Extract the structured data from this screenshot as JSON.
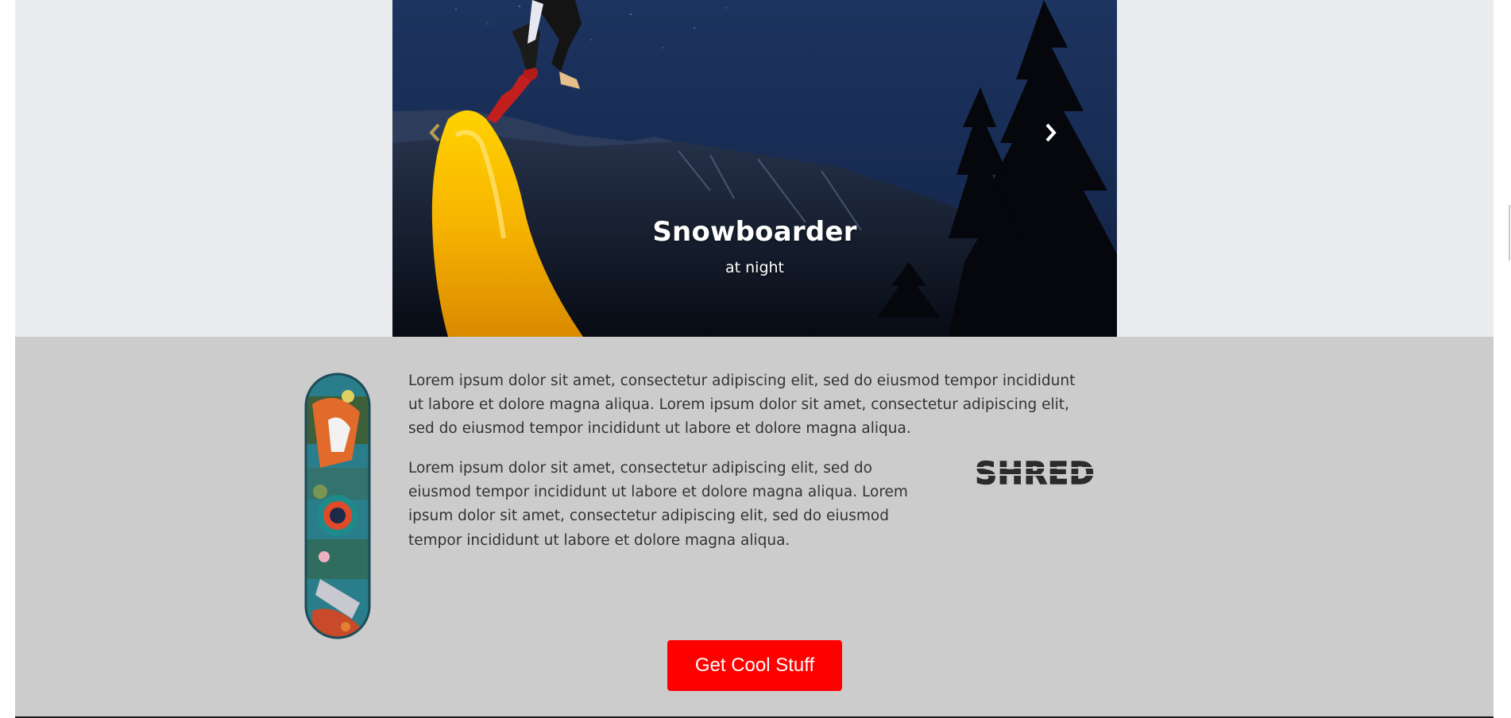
{
  "carousel": {
    "slide_title": "Snowboarder",
    "slide_subtitle": "at night",
    "prev_icon": "chevron-left-icon",
    "next_icon": "chevron-right-icon"
  },
  "content": {
    "paragraph_1": "Lorem ipsum dolor sit amet, consectetur adipiscing elit, sed do eiusmod tempor incididunt ut labore et dolore magna aliqua. Lorem ipsum dolor sit amet, consectetur adipiscing elit, sed do eiusmod tempor incididunt ut labore et dolore magna aliqua.",
    "paragraph_2": "Lorem ipsum dolor sit amet, consectetur adipiscing elit, sed do eiusmod tempor incididunt ut labore et dolore magna aliqua. Lorem ipsum dolor sit amet, consectetur adipiscing elit, sed do eiusmod tempor incididunt ut labore et dolore magna aliqua.",
    "logo_text": "SHRED",
    "cta_label": "Get Cool Stuff"
  },
  "colors": {
    "page_background": "#ebecef",
    "content_background": "#cccccc",
    "cta_background": "#ff0000",
    "cta_text": "#ffffff",
    "body_text": "#333333"
  }
}
